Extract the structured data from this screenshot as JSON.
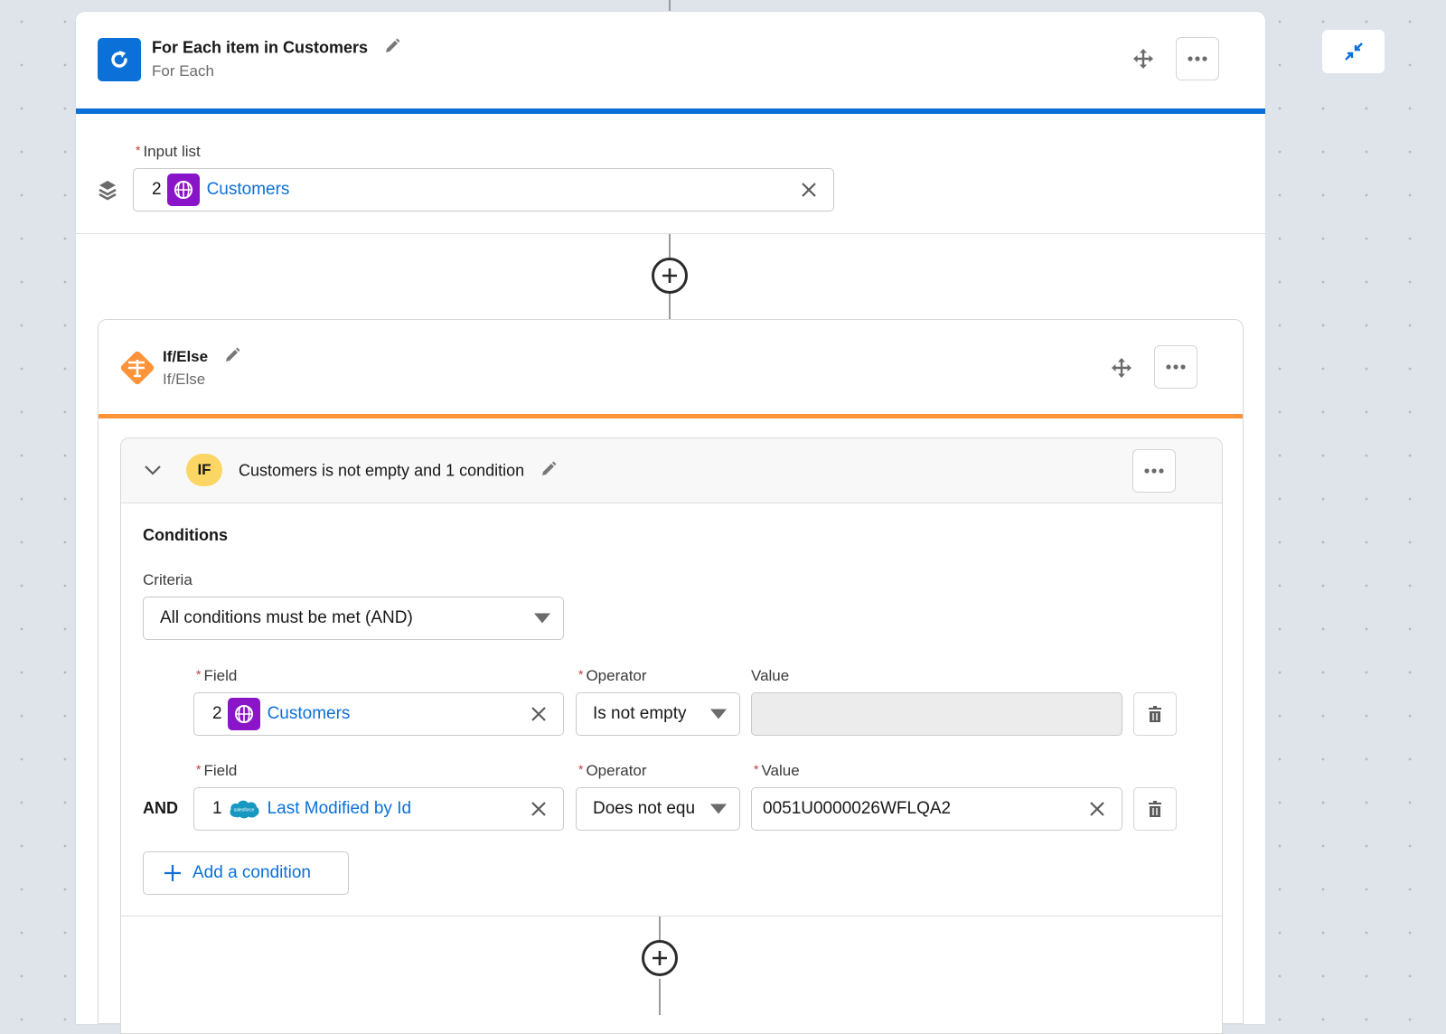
{
  "foreach_step": {
    "title": "For Each item in Customers",
    "subtitle": "For Each",
    "icon": "loop-refresh-icon",
    "accent_color": "#0b70d8",
    "input_list": {
      "label": "Input list",
      "required": true,
      "step_number": "2",
      "source_icon": "globe-icon",
      "value": "Customers"
    }
  },
  "ifelse_step": {
    "title": "If/Else",
    "subtitle": "If/Else",
    "icon": "signpost-icon",
    "accent_color": "#fe9339",
    "branch": {
      "badge": "IF",
      "summary": "Customers is not empty and 1 condition",
      "conditions_heading": "Conditions",
      "criteria": {
        "label": "Criteria",
        "selected": "All conditions must be met (AND)"
      },
      "conditions": [
        {
          "connector": "",
          "field_label": "Field",
          "field_step": "2",
          "field_icon": "globe-icon",
          "field_value": "Customers",
          "operator_label": "Operator",
          "operator_value": "Is not empty",
          "value_label": "Value",
          "value_required": false,
          "value": ""
        },
        {
          "connector": "AND",
          "field_label": "Field",
          "field_step": "1",
          "field_icon": "salesforce-cloud-icon",
          "field_value": "Last Modified by Id",
          "operator_label": "Operator",
          "operator_value": "Does not equ",
          "value_label": "Value",
          "value_required": true,
          "value": "0051U0000026WFLQA2"
        }
      ],
      "add_condition_label": "Add a condition"
    }
  },
  "salesforce_badge_text": "salesforce",
  "colors": {
    "link_blue": "#0b70d8",
    "required_red": "#c23934",
    "globe_badge_purple": "#8a14c8",
    "if_badge_yellow": "#fbd665",
    "canvas_bg": "#dfe3ea"
  }
}
